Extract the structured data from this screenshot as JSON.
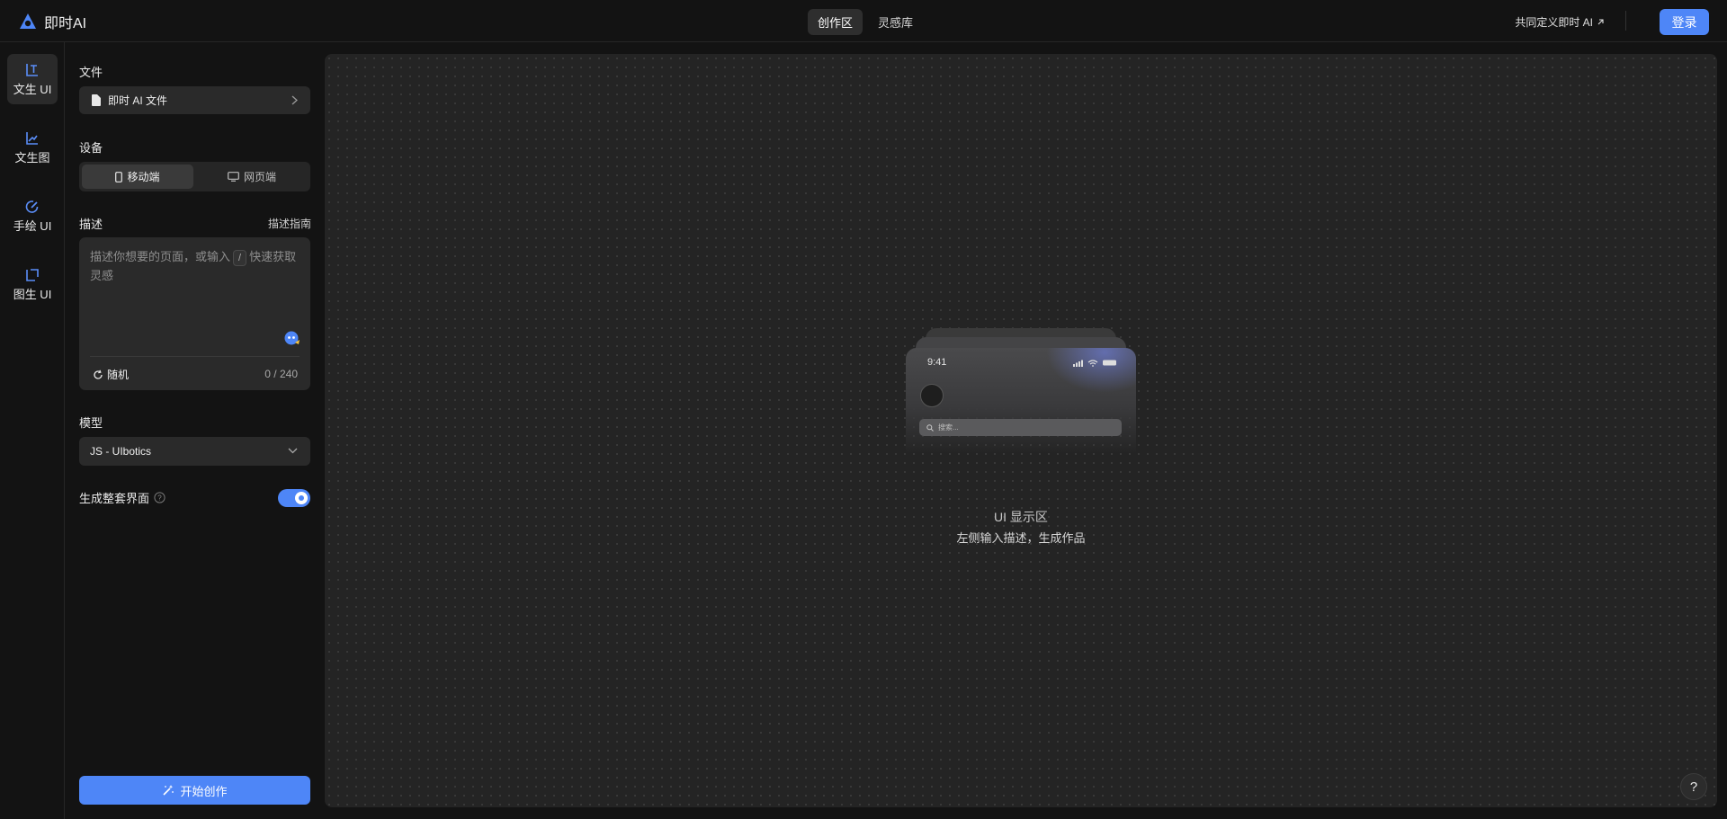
{
  "app": {
    "name": "即时AI"
  },
  "header": {
    "tabs": [
      {
        "label": "创作区",
        "active": true
      },
      {
        "label": "灵感库",
        "active": false
      }
    ],
    "cocreate_label": "共同定义即时 AI",
    "login_label": "登录"
  },
  "sidebar": {
    "items": [
      {
        "label": "文生 UI",
        "icon": "text-to-ui-icon",
        "active": true
      },
      {
        "label": "文生图",
        "icon": "text-to-image-icon",
        "active": false
      },
      {
        "label": "手绘 UI",
        "icon": "sketch-ui-icon",
        "active": false
      },
      {
        "label": "图生 UI",
        "icon": "image-to-ui-icon",
        "active": false
      }
    ]
  },
  "panel": {
    "file": {
      "section_label": "文件",
      "value": "即时 AI 文件"
    },
    "device": {
      "section_label": "设备",
      "options": [
        "移动端",
        "网页端"
      ],
      "selected": "移动端"
    },
    "description": {
      "section_label": "描述",
      "guide_link": "描述指南",
      "placeholder_before": "描述你想要的页面，或输入",
      "placeholder_key": "/",
      "placeholder_after": "快速获取灵感",
      "random_label": "随机",
      "counter": "0 / 240"
    },
    "model": {
      "section_label": "模型",
      "value": "JS - UIbotics"
    },
    "full_interface": {
      "label": "生成整套界面",
      "enabled": true
    },
    "start_label": "开始创作"
  },
  "canvas": {
    "preview": {
      "time": "9:41",
      "search_placeholder": "搜索..."
    },
    "empty_title": "UI 显示区",
    "empty_subtitle": "左侧输入描述，生成作品"
  },
  "help_fab_label": "?",
  "colors": {
    "accent": "#4e86f7",
    "background": "#131313",
    "panel": "#2a2a2a",
    "canvas": "#242424"
  }
}
